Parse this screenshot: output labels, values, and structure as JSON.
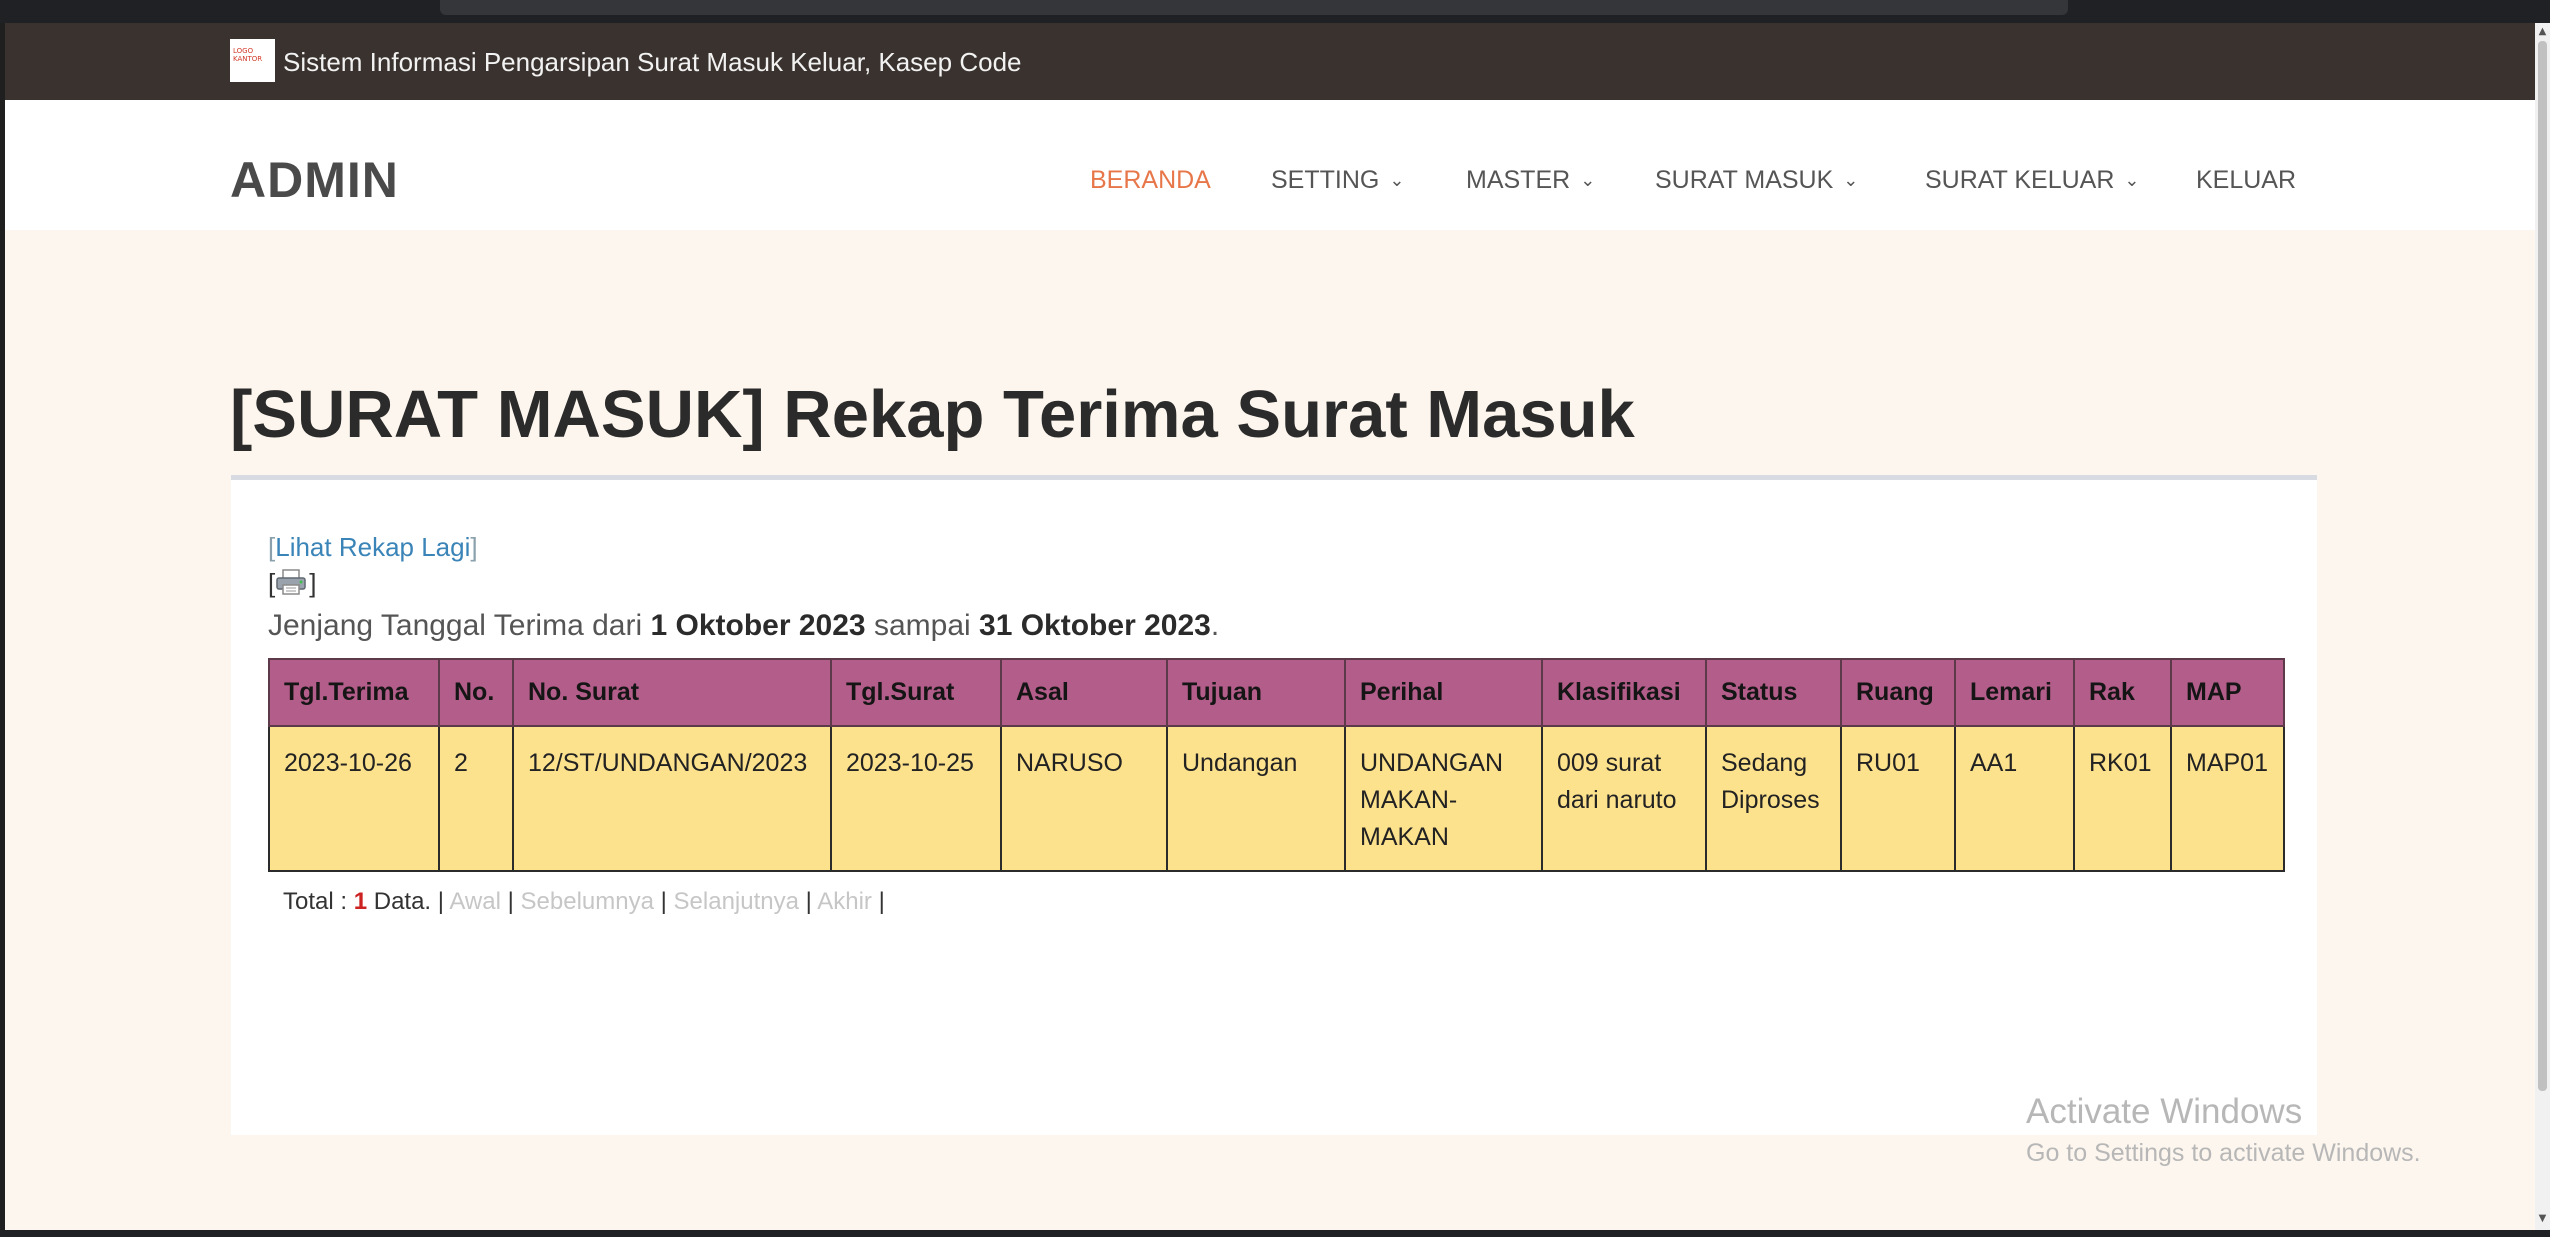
{
  "topbar": {
    "logo_text": "LOGO KANTOR",
    "title": "Sistem Informasi Pengarsipan Surat Masuk Keluar, Kasep Code"
  },
  "navbar": {
    "brand": "ADMIN",
    "items": [
      {
        "label": "BERANDA",
        "active": true,
        "dropdown": false
      },
      {
        "label": "SETTING",
        "active": false,
        "dropdown": true
      },
      {
        "label": "MASTER",
        "active": false,
        "dropdown": true
      },
      {
        "label": "SURAT MASUK",
        "active": false,
        "dropdown": true
      },
      {
        "label": "SURAT KELUAR",
        "active": false,
        "dropdown": true
      },
      {
        "label": "KELUAR",
        "active": false,
        "dropdown": false
      }
    ]
  },
  "page": {
    "title": "[SURAT MASUK] Rekap Terima Surat Masuk"
  },
  "rekap": {
    "link_label": "Lihat Rekap Lagi",
    "print_icon": "printer-icon",
    "range_prefix": "Jenjang Tanggal Terima dari",
    "date_from": "1 Oktober 2023",
    "range_mid": "sampai",
    "date_to": "31 Oktober 2023"
  },
  "table": {
    "headers": [
      "Tgl.Terima",
      "No.",
      "No. Surat",
      "Tgl.Surat",
      "Asal",
      "Tujuan",
      "Perihal",
      "Klasifikasi",
      "Status",
      "Ruang",
      "Lemari",
      "Rak",
      "MAP"
    ],
    "rows": [
      [
        "2023-10-26",
        "2",
        "12/ST/UNDANGAN/2023",
        "2023-10-25",
        "NARUSO",
        "Undangan",
        "UNDANGAN MAKAN-MAKAN",
        "009 surat dari naruto",
        "Sedang Diproses",
        "RU01",
        "AA1",
        "RK01",
        "MAP01"
      ]
    ],
    "header_color": "#b35d8a",
    "row_color": "#fde28e"
  },
  "pager": {
    "total_label": "Total :",
    "count": "1",
    "data_label": "Data.",
    "first": "Awal",
    "prev": "Sebelumnya",
    "next": "Selanjutnya",
    "last": "Akhir"
  },
  "watermark": {
    "line1": "Activate Windows",
    "line2": "Go to Settings to activate Windows."
  },
  "colors": {
    "accent": "#e7774a",
    "topbar": "#3a322e",
    "link": "#3a84b8"
  }
}
